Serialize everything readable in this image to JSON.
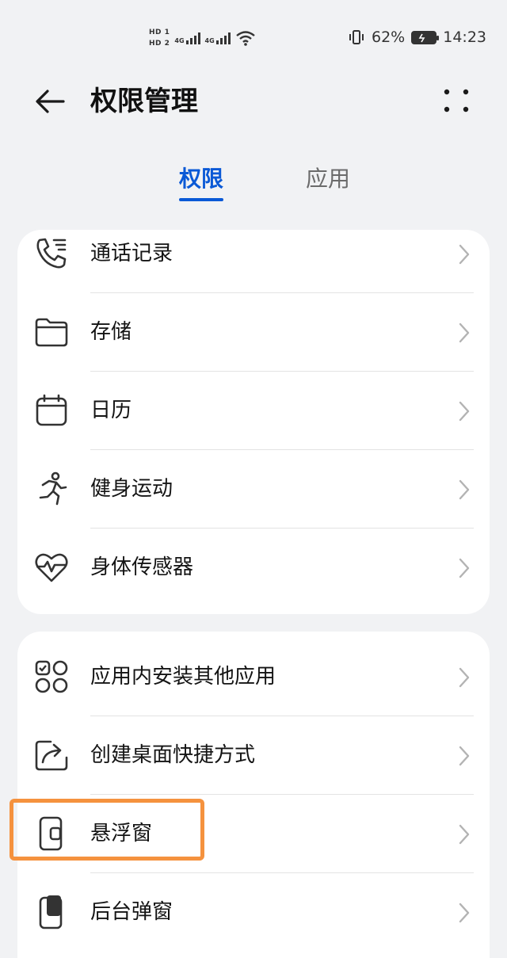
{
  "status_bar": {
    "sim1": "HD 1",
    "sim2": "HD 2",
    "net1": "4G",
    "net2": "4G",
    "battery_percent": "62%",
    "time": "14:23"
  },
  "header": {
    "title": "权限管理"
  },
  "tabs": [
    {
      "label": "权限",
      "active": true
    },
    {
      "label": "应用",
      "active": false
    }
  ],
  "group1": [
    {
      "label": "通话记录",
      "icon": "call-log-icon"
    },
    {
      "label": "存储",
      "icon": "folder-icon"
    },
    {
      "label": "日历",
      "icon": "calendar-icon"
    },
    {
      "label": "健身运动",
      "icon": "running-icon"
    },
    {
      "label": "身体传感器",
      "icon": "heart-pulse-icon"
    }
  ],
  "group2": [
    {
      "label": "应用内安装其他应用",
      "icon": "app-grid-icon"
    },
    {
      "label": "创建桌面快捷方式",
      "icon": "shortcut-icon"
    },
    {
      "label": "悬浮窗",
      "icon": "floating-window-icon",
      "highlighted": true
    },
    {
      "label": "后台弹窗",
      "icon": "background-popup-icon"
    }
  ],
  "colors": {
    "accent": "#0a59d6",
    "highlight": "#f5923e",
    "background": "#f1f2f4"
  }
}
